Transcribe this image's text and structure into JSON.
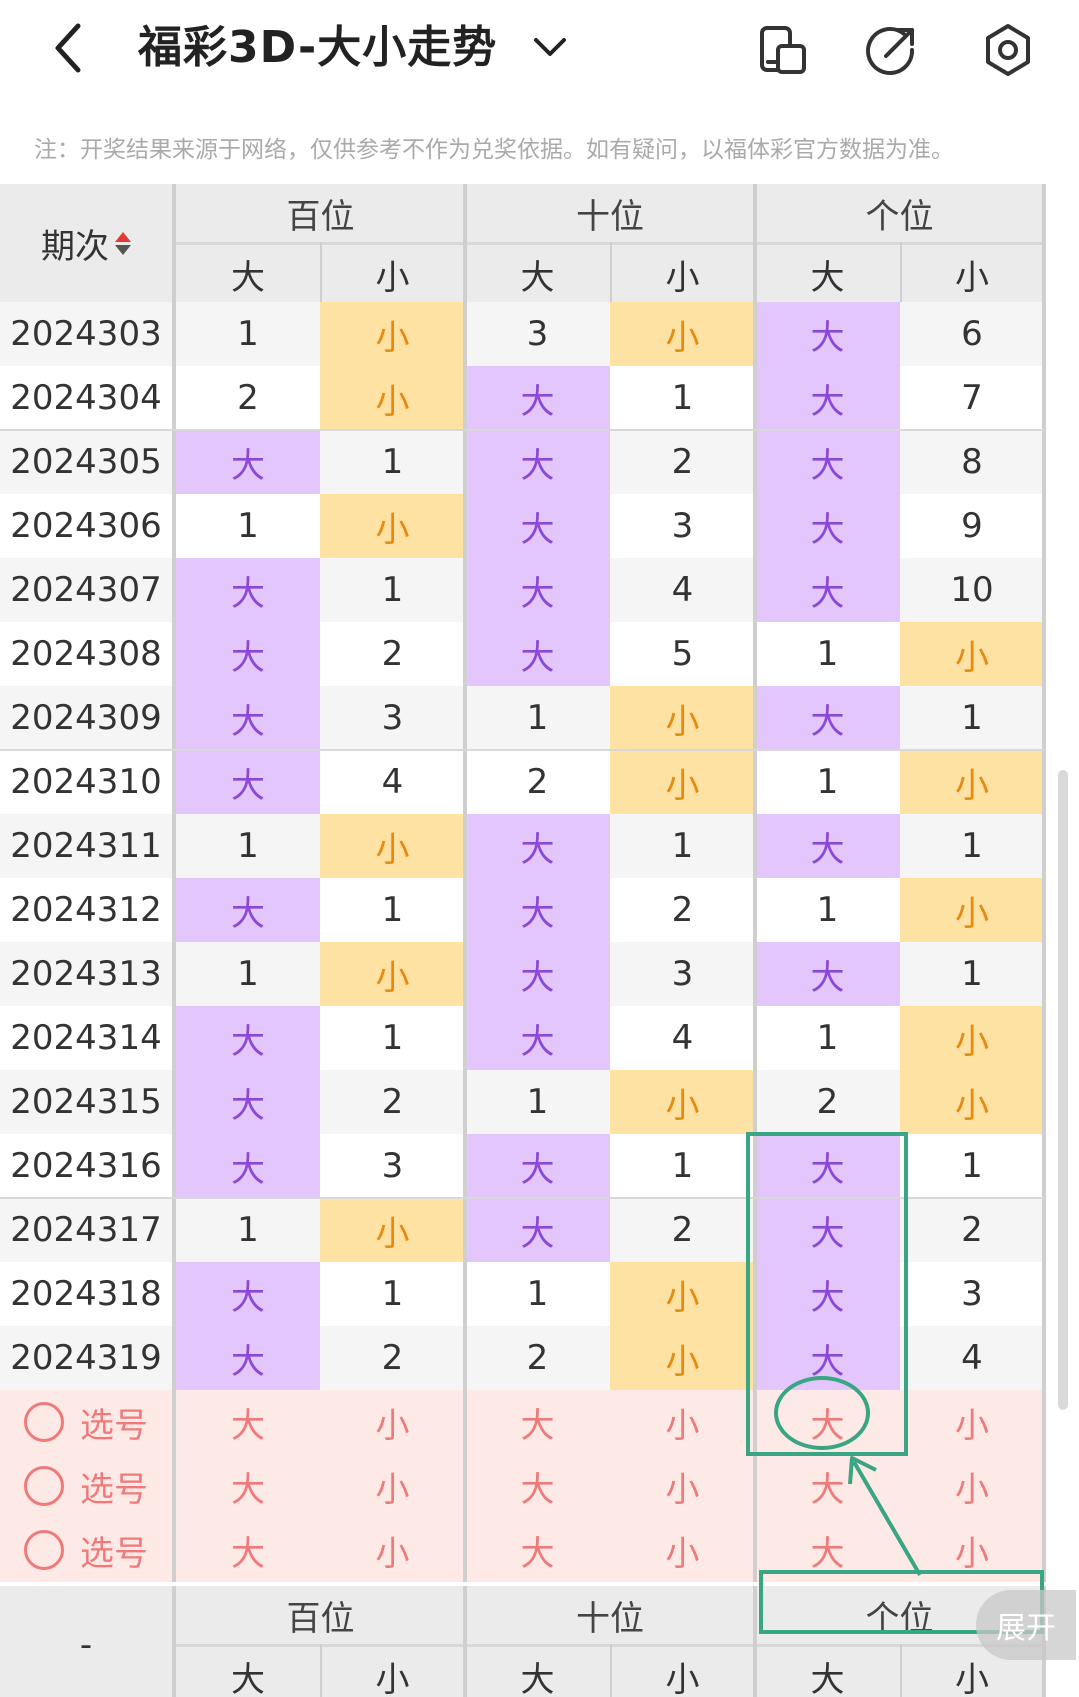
{
  "header": {
    "title": "福彩3D-大小走势",
    "icons": [
      "back-chevron-icon",
      "chevron-down-icon",
      "phone-layout-icon",
      "share-icon",
      "settings-icon"
    ]
  },
  "note": "注：开奖结果来源于网络，仅供参考不作为兑奖依据。如有疑问，以福体彩官方数据为准。",
  "table": {
    "period_header": "期次",
    "groups": [
      {
        "label": "百位",
        "cols": [
          "大",
          "小"
        ]
      },
      {
        "label": "十位",
        "cols": [
          "大",
          "小"
        ]
      },
      {
        "label": "个位",
        "cols": [
          "大",
          "小"
        ]
      }
    ],
    "rows": [
      {
        "period": "2024303",
        "cells": [
          "1",
          "小",
          "3",
          "小",
          "大",
          "6"
        ]
      },
      {
        "period": "2024304",
        "cells": [
          "2",
          "小",
          "大",
          "1",
          "大",
          "7"
        ]
      },
      {
        "period": "2024305",
        "cells": [
          "大",
          "1",
          "大",
          "2",
          "大",
          "8"
        ]
      },
      {
        "period": "2024306",
        "cells": [
          "1",
          "小",
          "大",
          "3",
          "大",
          "9"
        ]
      },
      {
        "period": "2024307",
        "cells": [
          "大",
          "1",
          "大",
          "4",
          "大",
          "10"
        ]
      },
      {
        "period": "2024308",
        "cells": [
          "大",
          "2",
          "大",
          "5",
          "1",
          "小"
        ]
      },
      {
        "period": "2024309",
        "cells": [
          "大",
          "3",
          "1",
          "小",
          "大",
          "1"
        ]
      },
      {
        "period": "2024310",
        "cells": [
          "大",
          "4",
          "2",
          "小",
          "1",
          "小"
        ]
      },
      {
        "period": "2024311",
        "cells": [
          "1",
          "小",
          "大",
          "1",
          "大",
          "1"
        ]
      },
      {
        "period": "2024312",
        "cells": [
          "大",
          "1",
          "大",
          "2",
          "1",
          "小"
        ]
      },
      {
        "period": "2024313",
        "cells": [
          "1",
          "小",
          "大",
          "3",
          "大",
          "1"
        ]
      },
      {
        "period": "2024314",
        "cells": [
          "大",
          "1",
          "大",
          "4",
          "1",
          "小"
        ]
      },
      {
        "period": "2024315",
        "cells": [
          "大",
          "2",
          "1",
          "小",
          "2",
          "小"
        ]
      },
      {
        "period": "2024316",
        "cells": [
          "大",
          "3",
          "大",
          "1",
          "大",
          "1"
        ]
      },
      {
        "period": "2024317",
        "cells": [
          "1",
          "小",
          "大",
          "2",
          "大",
          "2"
        ]
      },
      {
        "period": "2024318",
        "cells": [
          "大",
          "1",
          "1",
          "小",
          "大",
          "3"
        ]
      },
      {
        "period": "2024319",
        "cells": [
          "大",
          "2",
          "2",
          "小",
          "大",
          "4"
        ]
      }
    ],
    "select_rows": [
      {
        "label": "选号",
        "cells": [
          "大",
          "小",
          "大",
          "小",
          "大",
          "小"
        ]
      },
      {
        "label": "选号",
        "cells": [
          "大",
          "小",
          "大",
          "小",
          "大",
          "小"
        ]
      },
      {
        "label": "选号",
        "cells": [
          "大",
          "小",
          "大",
          "小",
          "大",
          "小"
        ]
      }
    ],
    "footer_period": "-",
    "footer_groups": [
      {
        "label": "百位",
        "cols": [
          "大",
          "小"
        ]
      },
      {
        "label": "十位",
        "cols": [
          "大",
          "小"
        ]
      },
      {
        "label": "个位",
        "cols": [
          "大",
          "小"
        ]
      }
    ]
  },
  "expand_label": "展开",
  "colors": {
    "da_text": "#8a48d6",
    "da_bg": "#e3c6fb",
    "xiao_text": "#e98a10",
    "xiao_bg": "#fde2a3",
    "select_bg": "#fdeae6",
    "select_text": "#f07a7a",
    "annotation": "#3aa583"
  }
}
